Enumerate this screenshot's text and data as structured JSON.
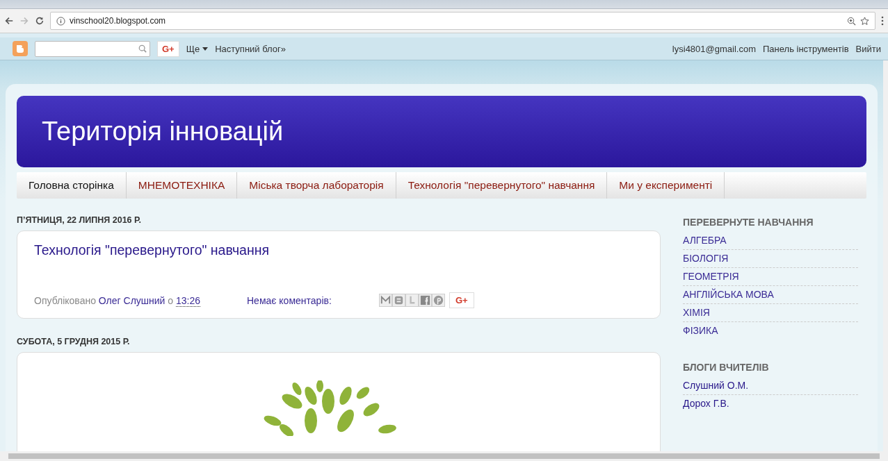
{
  "browser": {
    "url": "vinschool20.blogspot.com"
  },
  "navbar": {
    "gplus": "G+",
    "more": "Ще",
    "next_blog": "Наступний блог»",
    "account": "lysi4801@gmail.com",
    "dashboard": "Панель інструментів",
    "sign_out": "Вийти"
  },
  "header": {
    "title": "Територія інновацій"
  },
  "tabs": [
    {
      "label": "Головна сторінка",
      "selected": true
    },
    {
      "label": "МНЕМОТЕХНІКА",
      "selected": false
    },
    {
      "label": "Міська творча лабораторія",
      "selected": false
    },
    {
      "label": "Технологія \"перевернутого\" навчання",
      "selected": false
    },
    {
      "label": "Ми у експерименті",
      "selected": false
    }
  ],
  "posts": [
    {
      "date": "П’ЯТНИЦЯ, 22 ЛИПНЯ 2016 Р.",
      "title": "Технологія \"перевернутого\" навчання",
      "kind": "text",
      "footer": {
        "published": "Опубліковано",
        "author": "Олег Слушний",
        "at": "о",
        "time": "13:26",
        "comments": "Немає коментарів:",
        "share_gplus": "G+"
      }
    },
    {
      "date": "СУБОТА, 5 ГРУДНЯ 2015 Р.",
      "kind": "image"
    }
  ],
  "sidebar": [
    {
      "title": "ПЕРЕВЕРНУТЕ НАВЧАННЯ",
      "items": [
        "АЛГЕБРА",
        "БІОЛОГІЯ",
        "ГЕОМЕТРІЯ",
        "АНГЛІЙСЬКА МОВА",
        "ХІМІЯ",
        "ФІЗИКА"
      ]
    },
    {
      "title": "БЛОГИ ВЧИТЕЛІВ",
      "items": [
        "Слушний О.М.",
        "Дорох Г.В."
      ]
    }
  ]
}
